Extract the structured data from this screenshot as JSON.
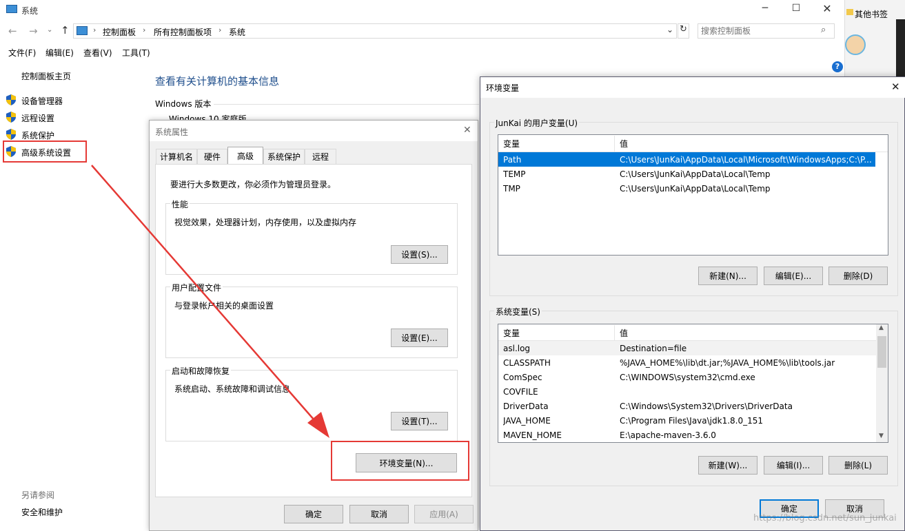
{
  "main_window": {
    "title": "系统",
    "breadcrumb": [
      "控制面板",
      "所有控制面板项",
      "系统"
    ],
    "search_placeholder": "搜索控制面板",
    "menu": [
      "文件(F)",
      "编辑(E)",
      "查看(V)",
      "工具(T)"
    ],
    "sidebar_home": "控制面板主页",
    "sidebar_items": [
      "设备管理器",
      "远程设置",
      "系统保护",
      "高级系统设置"
    ],
    "see_also_label": "另请参阅",
    "see_also_item": "安全和维护",
    "heading": "查看有关计算机的基本信息",
    "windows_version_label": "Windows 版本",
    "windows_edition_partial": "Windows 10 家庭版"
  },
  "browser_sidebar": {
    "bookmarks_label": "其他书签"
  },
  "sys_props": {
    "title": "系统属性",
    "tabs": [
      "计算机名",
      "硬件",
      "高级",
      "系统保护",
      "远程"
    ],
    "active_tab": "高级",
    "admin_note": "要进行大多数更改，你必须作为管理员登录。",
    "performance": {
      "title": "性能",
      "desc": "视觉效果，处理器计划，内存使用，以及虚拟内存",
      "button": "设置(S)..."
    },
    "user_profiles": {
      "title": "用户配置文件",
      "desc": "与登录帐户相关的桌面设置",
      "button": "设置(E)..."
    },
    "startup": {
      "title": "启动和故障恢复",
      "desc": "系统启动、系统故障和调试信息",
      "button": "设置(T)..."
    },
    "env_button": "环境变量(N)...",
    "ok": "确定",
    "cancel": "取消",
    "apply": "应用(A)"
  },
  "env_dialog": {
    "title": "环境变量",
    "user_group": "JunKai 的用户变量(U)",
    "col_var": "变量",
    "col_val": "值",
    "user_vars": [
      {
        "name": "Path",
        "value": "C:\\Users\\JunKai\\AppData\\Local\\Microsoft\\WindowsApps;C:\\P..."
      },
      {
        "name": "TEMP",
        "value": "C:\\Users\\JunKai\\AppData\\Local\\Temp"
      },
      {
        "name": "TMP",
        "value": "C:\\Users\\JunKai\\AppData\\Local\\Temp"
      }
    ],
    "user_buttons": [
      "新建(N)...",
      "编辑(E)...",
      "删除(D)"
    ],
    "sys_group": "系统变量(S)",
    "sys_vars": [
      {
        "name": "asl.log",
        "value": "Destination=file"
      },
      {
        "name": "CLASSPATH",
        "value": "%JAVA_HOME%\\lib\\dt.jar;%JAVA_HOME%\\lib\\tools.jar"
      },
      {
        "name": "ComSpec",
        "value": "C:\\WINDOWS\\system32\\cmd.exe"
      },
      {
        "name": "COVFILE",
        "value": ""
      },
      {
        "name": "DriverData",
        "value": "C:\\Windows\\System32\\Drivers\\DriverData"
      },
      {
        "name": "JAVA_HOME",
        "value": "C:\\Program Files\\Java\\jdk1.8.0_151"
      },
      {
        "name": "MAVEN_HOME",
        "value": "E:\\apache-maven-3.6.0"
      }
    ],
    "sys_buttons": [
      "新建(W)...",
      "编辑(I)...",
      "删除(L)"
    ],
    "ok": "确定",
    "cancel": "取消"
  },
  "watermark": "https://blog.csdn.net/sun_junkai",
  "colors": {
    "selection": "#0078d7",
    "annotation_red": "#e53935",
    "link_blue": "#1e4e8c"
  }
}
